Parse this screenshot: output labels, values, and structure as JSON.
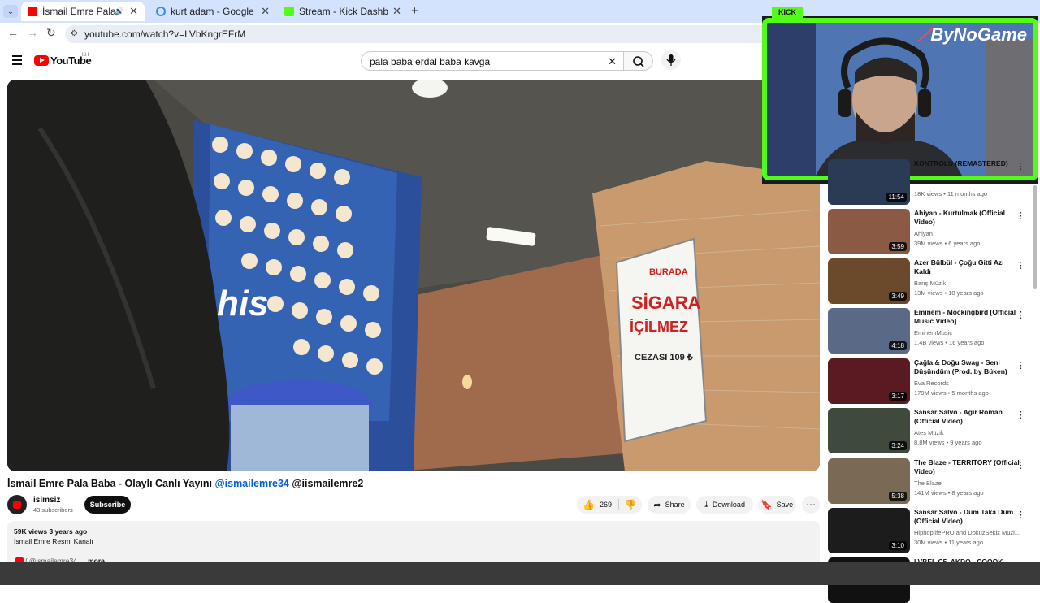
{
  "browser": {
    "tabs": [
      {
        "title": "İsmail Emre Pala Baba - Ola",
        "favicon": "youtube-icon",
        "active": true
      },
      {
        "title": "kurt adam - Google Search",
        "favicon": "google-icon",
        "active": false
      },
      {
        "title": "Stream - Kick Dashboard",
        "favicon": "kick-icon",
        "active": false
      }
    ],
    "url": "youtube.com/watch?v=LVbKngrEFrM"
  },
  "youtube": {
    "logo": "YouTube",
    "country_code": "KH",
    "search_query": "pala baba erdal baba kavga"
  },
  "video": {
    "sign_lines": [
      "BURADA",
      "SİGARA",
      "İÇİLMEZ",
      "CEZASI 109 ₺"
    ],
    "brand_text": "his",
    "title_plain": "İsmail Emre Pala Baba - Olaylı Canlı Yayını ",
    "title_link": "@ismailemre34",
    "title_suffix": " @iismailemre2"
  },
  "channel": {
    "name": "isimsiz",
    "subscribers": "43 subscribers",
    "subscribe_label": "Subscribe"
  },
  "actions": {
    "likes": "269",
    "share": "Share",
    "download": "Download",
    "save": "Save"
  },
  "description": {
    "views_date": "59K views  3 years ago",
    "line1": "İsmail Emre Resmi Kanalı",
    "handle": "/ @ismailemre34",
    "more": "...more"
  },
  "overlay": {
    "kick_label": "KICK",
    "brand": "ByNoGame"
  },
  "sidebar": [
    {
      "title": "KONTROLÜ (REMASTERED)",
      "channel": "",
      "meta": "18K views • 11 months ago",
      "duration": "11:54",
      "color": "#2b3a55"
    },
    {
      "title": "Ahiyan - Kurtulmak (Official Video)",
      "channel": "Ahiyan",
      "meta": "39M views • 6 years ago",
      "duration": "3:59",
      "color": "#8a5a44"
    },
    {
      "title": "Azer Bülbül - Çoğu Gitti Azı Kaldı",
      "channel": "Barış Müzik",
      "meta": "13M views • 10 years ago",
      "duration": "3:49",
      "color": "#6b4a2b"
    },
    {
      "title": "Eminem - Mockingbird [Official Music Video]",
      "channel": "EminemMusic",
      "meta": "1.4B views • 16 years ago",
      "duration": "4:18",
      "color": "#5a6a86"
    },
    {
      "title": "Çağla & Doğu Swag - Seni Düşündüm (Prod. by Büken)",
      "channel": "Eva Records",
      "meta": "179M views • 5 months ago",
      "duration": "3:17",
      "color": "#5a1a22"
    },
    {
      "title": "Sansar Salvo - Ağır Roman (Official Video)",
      "channel": "Ateş Müzik",
      "meta": "8.8M views • 9 years ago",
      "duration": "3:24",
      "color": "#3f4a3c"
    },
    {
      "title": "The Blaze - TERRITORY (Official Video)",
      "channel": "The Blaze",
      "meta": "141M views • 8 years ago",
      "duration": "5:38",
      "color": "#7a6a55"
    },
    {
      "title": "Sansar Salvo - Dum Taka Dum (Official Video)",
      "channel": "HiphoplifePRO and DokuzSekiz Müzi...",
      "meta": "30M views • 11 years ago",
      "duration": "3:10",
      "color": "#1c1c1c"
    },
    {
      "title": "LVBEL C5, AKDO - ÇOOOK",
      "channel": "",
      "meta": "",
      "duration": "",
      "color": "#111111"
    }
  ]
}
